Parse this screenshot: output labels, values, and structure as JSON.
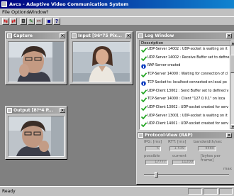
{
  "app": {
    "title": "Avcs - Adaptive Video Communication System",
    "menu": [
      "File",
      "Options",
      "Window",
      "?"
    ],
    "toolbar_icons": [
      "connect-icon",
      "disconnect-icon",
      "camera-icon",
      "settings-icon",
      "tools-icon",
      "window-icon",
      "help-icon"
    ],
    "status_text": "Ready"
  },
  "windows": {
    "capture": {
      "title": "Capture"
    },
    "input": {
      "title": "Input [96*75 Pix..."
    },
    "output": {
      "title": "Output [8?*4 P..."
    },
    "log": {
      "title": "Log Window",
      "column": "Description",
      "rows": [
        {
          "icon": "check",
          "text": "UDP-Server 14002 : UDP-socket is waiting on it"
        },
        {
          "icon": "check",
          "text": "UDP-Server 14002 : Receive Buffer set to define"
        },
        {
          "icon": "info",
          "text": "RAP-Server created"
        },
        {
          "icon": "check",
          "text": "TCP-Server 14000 : Waiting for connection of cl"
        },
        {
          "icon": "info",
          "text": "TCP Socket to: localhost connected on local po"
        },
        {
          "icon": "check",
          "text": "UDP-Client 13002 : Send Buffer set to defined v"
        },
        {
          "icon": "check",
          "text": "TCP-Server 14000 : Client \"127.0.0.1\" on loca"
        },
        {
          "icon": "check",
          "text": "UDP-Client 13002 : UDP-socket created for serv"
        },
        {
          "icon": "check",
          "text": "UDP-Server 13001 : UDP-socket is waiting on it"
        },
        {
          "icon": "check",
          "text": "UDP-Client 14001 : UDP-socket created for serv"
        }
      ]
    },
    "protocol": {
      "title": "Protocol-View (RAP)",
      "labels": {
        "ipg": "IPG: [ms]",
        "rtt": "RTT: [ms]",
        "bandwidth": "bandwidth/sec",
        "possible": "possible",
        "current": "current",
        "bytes_per_frame": "[bytes per frame]",
        "max": "max"
      },
      "values": {
        "ipg": "5",
        "rtt": "1.539",
        "bandwidth": "4480",
        "possible": "17777",
        "current": "11200"
      },
      "slider_fraction": 0.13
    }
  }
}
